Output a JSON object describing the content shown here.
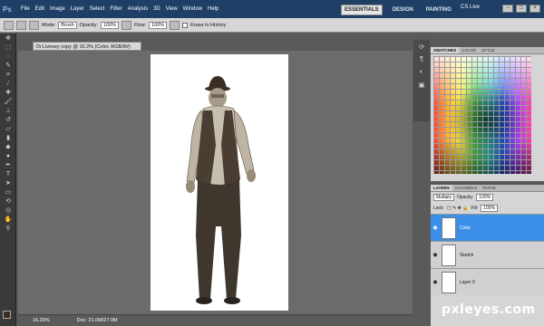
{
  "app": {
    "logo": "Ps",
    "zoom": "16.2"
  },
  "menu": [
    "File",
    "Edit",
    "Image",
    "Layer",
    "Select",
    "Filter",
    "Analysis",
    "3D",
    "View",
    "Window",
    "Help"
  ],
  "workspaces": {
    "essentials": "ESSENTIALS",
    "design": "DESIGN",
    "painting": "PAINTING",
    "cslive": "CS Live"
  },
  "options": {
    "mode_label": "Mode:",
    "mode": "Brush",
    "opacity_label": "Opacity:",
    "opacity": "100%",
    "flow_label": "Flow:",
    "flow": "100%",
    "erase_history": "Erase to History"
  },
  "document": {
    "tab": "Dr.Livesey copy @ 16.2% (Color, RGB/8#)"
  },
  "status": {
    "zoom": "16.26%",
    "doc": "Doc: 21.0M/27.0M"
  },
  "swatches": {
    "tabs": [
      "SWATCHES",
      "COLOR",
      "STYLE"
    ]
  },
  "layers": {
    "tabs": [
      "LAYERS",
      "CHANNELS",
      "PATHS"
    ],
    "blend": "Multiply",
    "opacity_label": "Opacity:",
    "opacity": "100%",
    "lock_label": "Lock:",
    "fill_label": "Fill:",
    "fill": "100%",
    "items": [
      {
        "name": "Color"
      },
      {
        "name": "Sketch"
      },
      {
        "name": "Layer 0"
      }
    ]
  },
  "watermark": "pxleyes.com"
}
